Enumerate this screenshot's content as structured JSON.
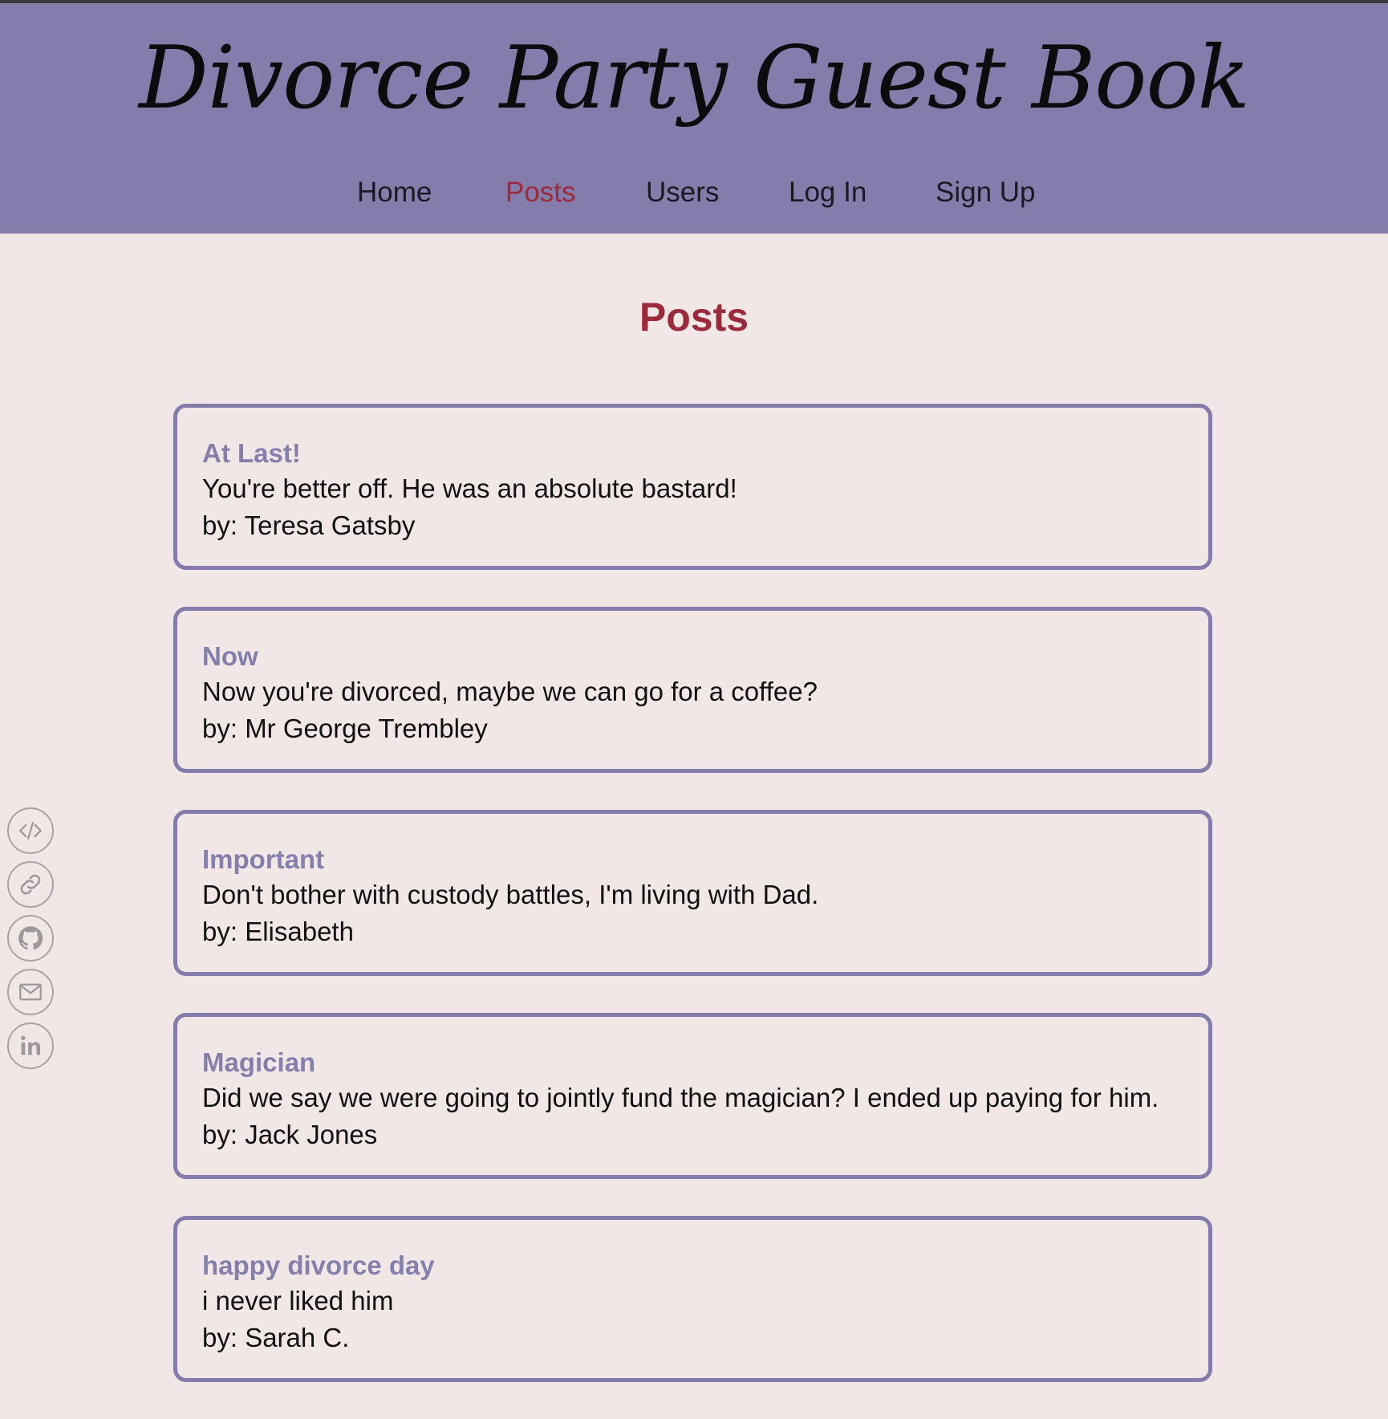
{
  "site": {
    "title": "Divorce Party Guest Book"
  },
  "nav": {
    "items": [
      {
        "label": "Home"
      },
      {
        "label": "Posts"
      },
      {
        "label": "Users"
      },
      {
        "label": "Log In"
      },
      {
        "label": "Sign Up"
      }
    ],
    "active": "Posts"
  },
  "main": {
    "heading": "Posts",
    "posts": [
      {
        "title": "At Last!",
        "body": "You're better off. He was an absolute bastard!",
        "author": "by: Teresa Gatsby"
      },
      {
        "title": "Now",
        "body": "Now you're divorced, maybe we can go for a coffee?",
        "author": "by: Mr George Trembley"
      },
      {
        "title": "Important",
        "body": "Don't bother with custody battles, I'm living with Dad.",
        "author": "by: Elisabeth"
      },
      {
        "title": "Magician",
        "body": "Did we say we were going to jointly fund the magician? I ended up paying for him.",
        "author": "by: Jack Jones"
      },
      {
        "title": "happy divorce day",
        "body": "i never liked him",
        "author": "by: Sarah C."
      }
    ]
  },
  "social": {
    "icons": [
      "code-icon",
      "link-icon",
      "github-icon",
      "mail-icon",
      "linkedin-icon"
    ]
  },
  "colors": {
    "header_bg": "#847caa",
    "page_bg": "#f2e7e7",
    "accent": "#9a2a3c",
    "post_title": "#857fab",
    "card_border": "#847caa"
  }
}
